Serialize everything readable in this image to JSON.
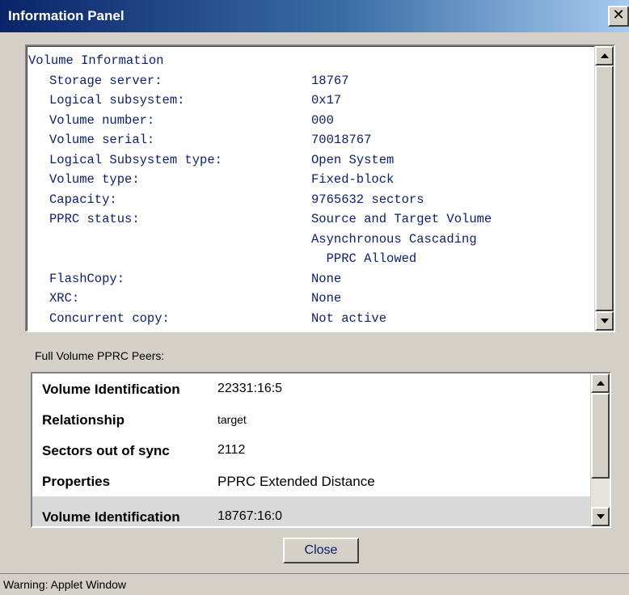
{
  "window": {
    "title": "Information Panel",
    "close_icon": "close-icon"
  },
  "volume_info": {
    "heading": "Volume Information",
    "fields": [
      {
        "label": "Storage server:",
        "value": "18767"
      },
      {
        "label": "Logical subsystem:",
        "value": "0x17"
      },
      {
        "label": "Volume number:",
        "value": "000"
      },
      {
        "label": "Volume serial:",
        "value": "70018767"
      },
      {
        "label": "Logical Subsystem type:",
        "value": "Open System"
      },
      {
        "label": "Volume type:",
        "value": "Fixed-block"
      },
      {
        "label": "Capacity:",
        "value": "9765632 sectors"
      },
      {
        "label": "PPRC status:",
        "value": "Source and Target Volume"
      },
      {
        "label": "",
        "value": "Asynchronous Cascading"
      },
      {
        "label": "",
        "value": "  PPRC Allowed"
      },
      {
        "label": "FlashCopy:",
        "value": "None"
      },
      {
        "label": "XRC:",
        "value": "None"
      },
      {
        "label": "Concurrent copy:",
        "value": "Not active"
      }
    ]
  },
  "peers": {
    "section_label": "Full Volume PPRC Peers:",
    "groups": [
      {
        "rows": [
          {
            "key": "Volume Identification",
            "value": "22331:16:5"
          },
          {
            "key": "Relationship",
            "value": "target"
          },
          {
            "key": "Sectors out of sync",
            "value": "2112"
          },
          {
            "key": "Properties",
            "value": "PPRC Extended Distance"
          }
        ]
      },
      {
        "rows": [
          {
            "key": "Volume Identification",
            "value": "18767:16:0"
          }
        ]
      }
    ]
  },
  "buttons": {
    "close_label": "Close"
  },
  "status_bar": {
    "text": "Warning: Applet Window"
  },
  "colors": {
    "title_bar": "#0a246a",
    "text_blue": "#0a1f66",
    "selected_row": "#d9d9d9",
    "face": "#d4d0c8"
  }
}
